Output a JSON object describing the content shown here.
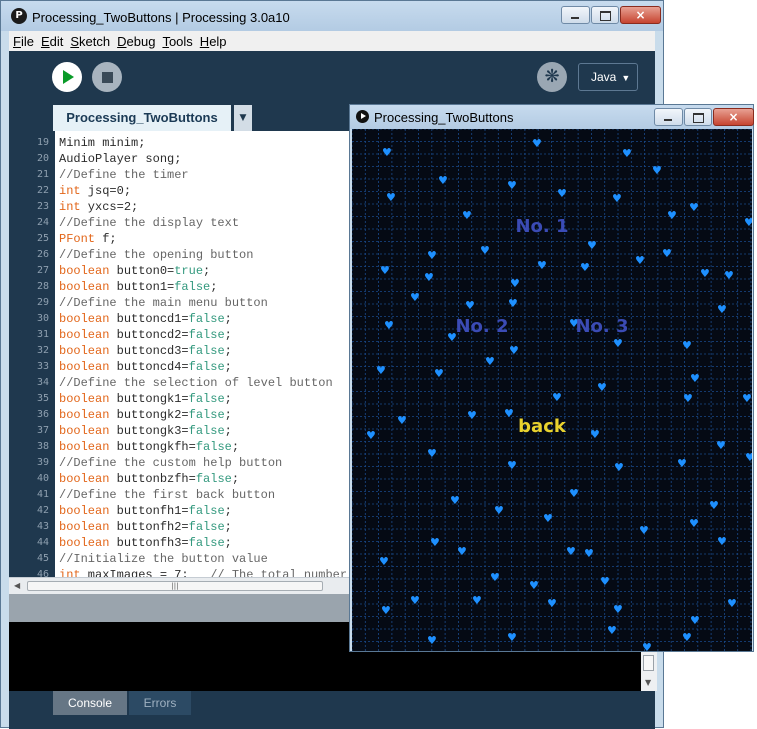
{
  "ide": {
    "title": "Processing_TwoButtons | Processing 3.0a10",
    "logo": "P",
    "window_controls": {
      "minimize": "minimize-icon",
      "maximize": "maximize-icon",
      "close": "×"
    },
    "menu": [
      {
        "mnemonic": "F",
        "rest": "ile"
      },
      {
        "mnemonic": "E",
        "rest": "dit"
      },
      {
        "mnemonic": "S",
        "rest": "ketch"
      },
      {
        "mnemonic": "D",
        "rest": "ebug"
      },
      {
        "mnemonic": "T",
        "rest": "ools"
      },
      {
        "mnemonic": "H",
        "rest": "elp"
      }
    ],
    "toolbar": {
      "run_icon": "play-icon",
      "stop_icon": "stop-icon",
      "debug_icon": "butterfly-icon",
      "debug_glyph": "❋",
      "mode": "Java",
      "mode_caret": "▼"
    },
    "tab": {
      "name": "Processing_TwoButtons",
      "menu_caret": "▼"
    },
    "code_lines": [
      {
        "n": "19",
        "tokens": [
          [
            "t",
            "Minim minim;"
          ]
        ]
      },
      {
        "n": "20",
        "tokens": [
          [
            "t",
            "AudioPlayer song;"
          ]
        ]
      },
      {
        "n": "21",
        "tokens": [
          [
            "c",
            "//Define the timer"
          ]
        ]
      },
      {
        "n": "22",
        "tokens": [
          [
            "k",
            "int"
          ],
          [
            "t",
            " jsq=0;"
          ]
        ]
      },
      {
        "n": "23",
        "tokens": [
          [
            "k",
            "int"
          ],
          [
            "t",
            " yxcs=2;"
          ]
        ]
      },
      {
        "n": "24",
        "tokens": [
          [
            "c",
            "//Define the display text"
          ]
        ]
      },
      {
        "n": "25",
        "tokens": [
          [
            "k",
            "PFont"
          ],
          [
            "t",
            " f;"
          ]
        ]
      },
      {
        "n": "26",
        "tokens": [
          [
            "c",
            "//Define the opening button"
          ]
        ]
      },
      {
        "n": "27",
        "tokens": [
          [
            "k",
            "boolean"
          ],
          [
            "t",
            " button0="
          ],
          [
            "l",
            "true"
          ],
          [
            "t",
            ";"
          ]
        ]
      },
      {
        "n": "28",
        "tokens": [
          [
            "k",
            "boolean"
          ],
          [
            "t",
            " button1="
          ],
          [
            "l",
            "false"
          ],
          [
            "t",
            ";"
          ]
        ]
      },
      {
        "n": "29",
        "tokens": [
          [
            "c",
            "//Define the main menu button"
          ]
        ]
      },
      {
        "n": "30",
        "tokens": [
          [
            "k",
            "boolean"
          ],
          [
            "t",
            " buttoncd1="
          ],
          [
            "l",
            "false"
          ],
          [
            "t",
            ";"
          ]
        ]
      },
      {
        "n": "31",
        "tokens": [
          [
            "k",
            "boolean"
          ],
          [
            "t",
            " buttoncd2="
          ],
          [
            "l",
            "false"
          ],
          [
            "t",
            ";"
          ]
        ]
      },
      {
        "n": "32",
        "tokens": [
          [
            "k",
            "boolean"
          ],
          [
            "t",
            " buttoncd3="
          ],
          [
            "l",
            "false"
          ],
          [
            "t",
            ";"
          ]
        ]
      },
      {
        "n": "33",
        "tokens": [
          [
            "k",
            "boolean"
          ],
          [
            "t",
            " buttoncd4="
          ],
          [
            "l",
            "false"
          ],
          [
            "t",
            ";"
          ]
        ]
      },
      {
        "n": "34",
        "tokens": [
          [
            "c",
            "//Define the selection of level button"
          ]
        ]
      },
      {
        "n": "35",
        "tokens": [
          [
            "k",
            "boolean"
          ],
          [
            "t",
            " buttongk1="
          ],
          [
            "l",
            "false"
          ],
          [
            "t",
            ";"
          ]
        ]
      },
      {
        "n": "36",
        "tokens": [
          [
            "k",
            "boolean"
          ],
          [
            "t",
            " buttongk2="
          ],
          [
            "l",
            "false"
          ],
          [
            "t",
            ";"
          ]
        ]
      },
      {
        "n": "37",
        "tokens": [
          [
            "k",
            "boolean"
          ],
          [
            "t",
            " buttongk3="
          ],
          [
            "l",
            "false"
          ],
          [
            "t",
            ";"
          ]
        ]
      },
      {
        "n": "38",
        "tokens": [
          [
            "k",
            "boolean"
          ],
          [
            "t",
            " buttongkfh="
          ],
          [
            "l",
            "false"
          ],
          [
            "t",
            ";"
          ]
        ]
      },
      {
        "n": "39",
        "tokens": [
          [
            "c",
            "//Define the custom help button"
          ]
        ]
      },
      {
        "n": "40",
        "tokens": [
          [
            "k",
            "boolean"
          ],
          [
            "t",
            " buttonbzfh="
          ],
          [
            "l",
            "false"
          ],
          [
            "t",
            ";"
          ]
        ]
      },
      {
        "n": "41",
        "tokens": [
          [
            "c",
            "//Define the first back button"
          ]
        ]
      },
      {
        "n": "42",
        "tokens": [
          [
            "k",
            "boolean"
          ],
          [
            "t",
            " buttonfh1="
          ],
          [
            "l",
            "false"
          ],
          [
            "t",
            ";"
          ]
        ]
      },
      {
        "n": "43",
        "tokens": [
          [
            "k",
            "boolean"
          ],
          [
            "t",
            " buttonfh2="
          ],
          [
            "l",
            "false"
          ],
          [
            "t",
            ";"
          ]
        ]
      },
      {
        "n": "44",
        "tokens": [
          [
            "k",
            "boolean"
          ],
          [
            "t",
            " buttonfh3="
          ],
          [
            "l",
            "false"
          ],
          [
            "t",
            ";"
          ]
        ]
      },
      {
        "n": "45",
        "tokens": [
          [
            "c",
            "//Initialize the button value"
          ]
        ]
      },
      {
        "n": "46",
        "tokens": [
          [
            "k",
            "int"
          ],
          [
            "t",
            " maxImages = 7;   "
          ],
          [
            "c",
            "// The total number o"
          ]
        ]
      }
    ],
    "hscroll_grip": "|||",
    "footer_tabs": [
      "Console",
      "Errors"
    ]
  },
  "sketch": {
    "title": "Processing_TwoButtons",
    "buttons": {
      "no1": "No. 1",
      "no2": "No. 2",
      "no3": "No. 3",
      "back": "back"
    },
    "heart_glyph": "♥",
    "colors": {
      "background": "#050a14",
      "grid": "#1a4a8a",
      "heart": "#1e90ff",
      "menu_text": "#3b4bb5",
      "back_text": "#e8d22e"
    }
  },
  "colors": {
    "ide_dark": "#1f384e",
    "keyword": "#e2661a",
    "literal": "#33997e",
    "comment": "#666666"
  }
}
